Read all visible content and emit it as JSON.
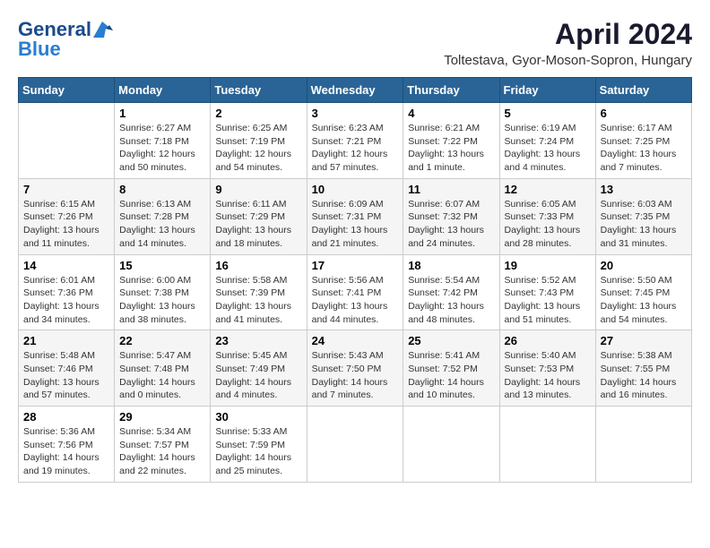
{
  "header": {
    "logo_line1": "General",
    "logo_line2": "Blue",
    "month_year": "April 2024",
    "location": "Toltestava, Gyor-Moson-Sopron, Hungary"
  },
  "weekdays": [
    "Sunday",
    "Monday",
    "Tuesday",
    "Wednesday",
    "Thursday",
    "Friday",
    "Saturday"
  ],
  "weeks": [
    [
      {
        "day": "",
        "content": ""
      },
      {
        "day": "1",
        "content": "Sunrise: 6:27 AM\nSunset: 7:18 PM\nDaylight: 12 hours\nand 50 minutes."
      },
      {
        "day": "2",
        "content": "Sunrise: 6:25 AM\nSunset: 7:19 PM\nDaylight: 12 hours\nand 54 minutes."
      },
      {
        "day": "3",
        "content": "Sunrise: 6:23 AM\nSunset: 7:21 PM\nDaylight: 12 hours\nand 57 minutes."
      },
      {
        "day": "4",
        "content": "Sunrise: 6:21 AM\nSunset: 7:22 PM\nDaylight: 13 hours\nand 1 minute."
      },
      {
        "day": "5",
        "content": "Sunrise: 6:19 AM\nSunset: 7:24 PM\nDaylight: 13 hours\nand 4 minutes."
      },
      {
        "day": "6",
        "content": "Sunrise: 6:17 AM\nSunset: 7:25 PM\nDaylight: 13 hours\nand 7 minutes."
      }
    ],
    [
      {
        "day": "7",
        "content": "Sunrise: 6:15 AM\nSunset: 7:26 PM\nDaylight: 13 hours\nand 11 minutes."
      },
      {
        "day": "8",
        "content": "Sunrise: 6:13 AM\nSunset: 7:28 PM\nDaylight: 13 hours\nand 14 minutes."
      },
      {
        "day": "9",
        "content": "Sunrise: 6:11 AM\nSunset: 7:29 PM\nDaylight: 13 hours\nand 18 minutes."
      },
      {
        "day": "10",
        "content": "Sunrise: 6:09 AM\nSunset: 7:31 PM\nDaylight: 13 hours\nand 21 minutes."
      },
      {
        "day": "11",
        "content": "Sunrise: 6:07 AM\nSunset: 7:32 PM\nDaylight: 13 hours\nand 24 minutes."
      },
      {
        "day": "12",
        "content": "Sunrise: 6:05 AM\nSunset: 7:33 PM\nDaylight: 13 hours\nand 28 minutes."
      },
      {
        "day": "13",
        "content": "Sunrise: 6:03 AM\nSunset: 7:35 PM\nDaylight: 13 hours\nand 31 minutes."
      }
    ],
    [
      {
        "day": "14",
        "content": "Sunrise: 6:01 AM\nSunset: 7:36 PM\nDaylight: 13 hours\nand 34 minutes."
      },
      {
        "day": "15",
        "content": "Sunrise: 6:00 AM\nSunset: 7:38 PM\nDaylight: 13 hours\nand 38 minutes."
      },
      {
        "day": "16",
        "content": "Sunrise: 5:58 AM\nSunset: 7:39 PM\nDaylight: 13 hours\nand 41 minutes."
      },
      {
        "day": "17",
        "content": "Sunrise: 5:56 AM\nSunset: 7:41 PM\nDaylight: 13 hours\nand 44 minutes."
      },
      {
        "day": "18",
        "content": "Sunrise: 5:54 AM\nSunset: 7:42 PM\nDaylight: 13 hours\nand 48 minutes."
      },
      {
        "day": "19",
        "content": "Sunrise: 5:52 AM\nSunset: 7:43 PM\nDaylight: 13 hours\nand 51 minutes."
      },
      {
        "day": "20",
        "content": "Sunrise: 5:50 AM\nSunset: 7:45 PM\nDaylight: 13 hours\nand 54 minutes."
      }
    ],
    [
      {
        "day": "21",
        "content": "Sunrise: 5:48 AM\nSunset: 7:46 PM\nDaylight: 13 hours\nand 57 minutes."
      },
      {
        "day": "22",
        "content": "Sunrise: 5:47 AM\nSunset: 7:48 PM\nDaylight: 14 hours\nand 0 minutes."
      },
      {
        "day": "23",
        "content": "Sunrise: 5:45 AM\nSunset: 7:49 PM\nDaylight: 14 hours\nand 4 minutes."
      },
      {
        "day": "24",
        "content": "Sunrise: 5:43 AM\nSunset: 7:50 PM\nDaylight: 14 hours\nand 7 minutes."
      },
      {
        "day": "25",
        "content": "Sunrise: 5:41 AM\nSunset: 7:52 PM\nDaylight: 14 hours\nand 10 minutes."
      },
      {
        "day": "26",
        "content": "Sunrise: 5:40 AM\nSunset: 7:53 PM\nDaylight: 14 hours\nand 13 minutes."
      },
      {
        "day": "27",
        "content": "Sunrise: 5:38 AM\nSunset: 7:55 PM\nDaylight: 14 hours\nand 16 minutes."
      }
    ],
    [
      {
        "day": "28",
        "content": "Sunrise: 5:36 AM\nSunset: 7:56 PM\nDaylight: 14 hours\nand 19 minutes."
      },
      {
        "day": "29",
        "content": "Sunrise: 5:34 AM\nSunset: 7:57 PM\nDaylight: 14 hours\nand 22 minutes."
      },
      {
        "day": "30",
        "content": "Sunrise: 5:33 AM\nSunset: 7:59 PM\nDaylight: 14 hours\nand 25 minutes."
      },
      {
        "day": "",
        "content": ""
      },
      {
        "day": "",
        "content": ""
      },
      {
        "day": "",
        "content": ""
      },
      {
        "day": "",
        "content": ""
      }
    ]
  ]
}
